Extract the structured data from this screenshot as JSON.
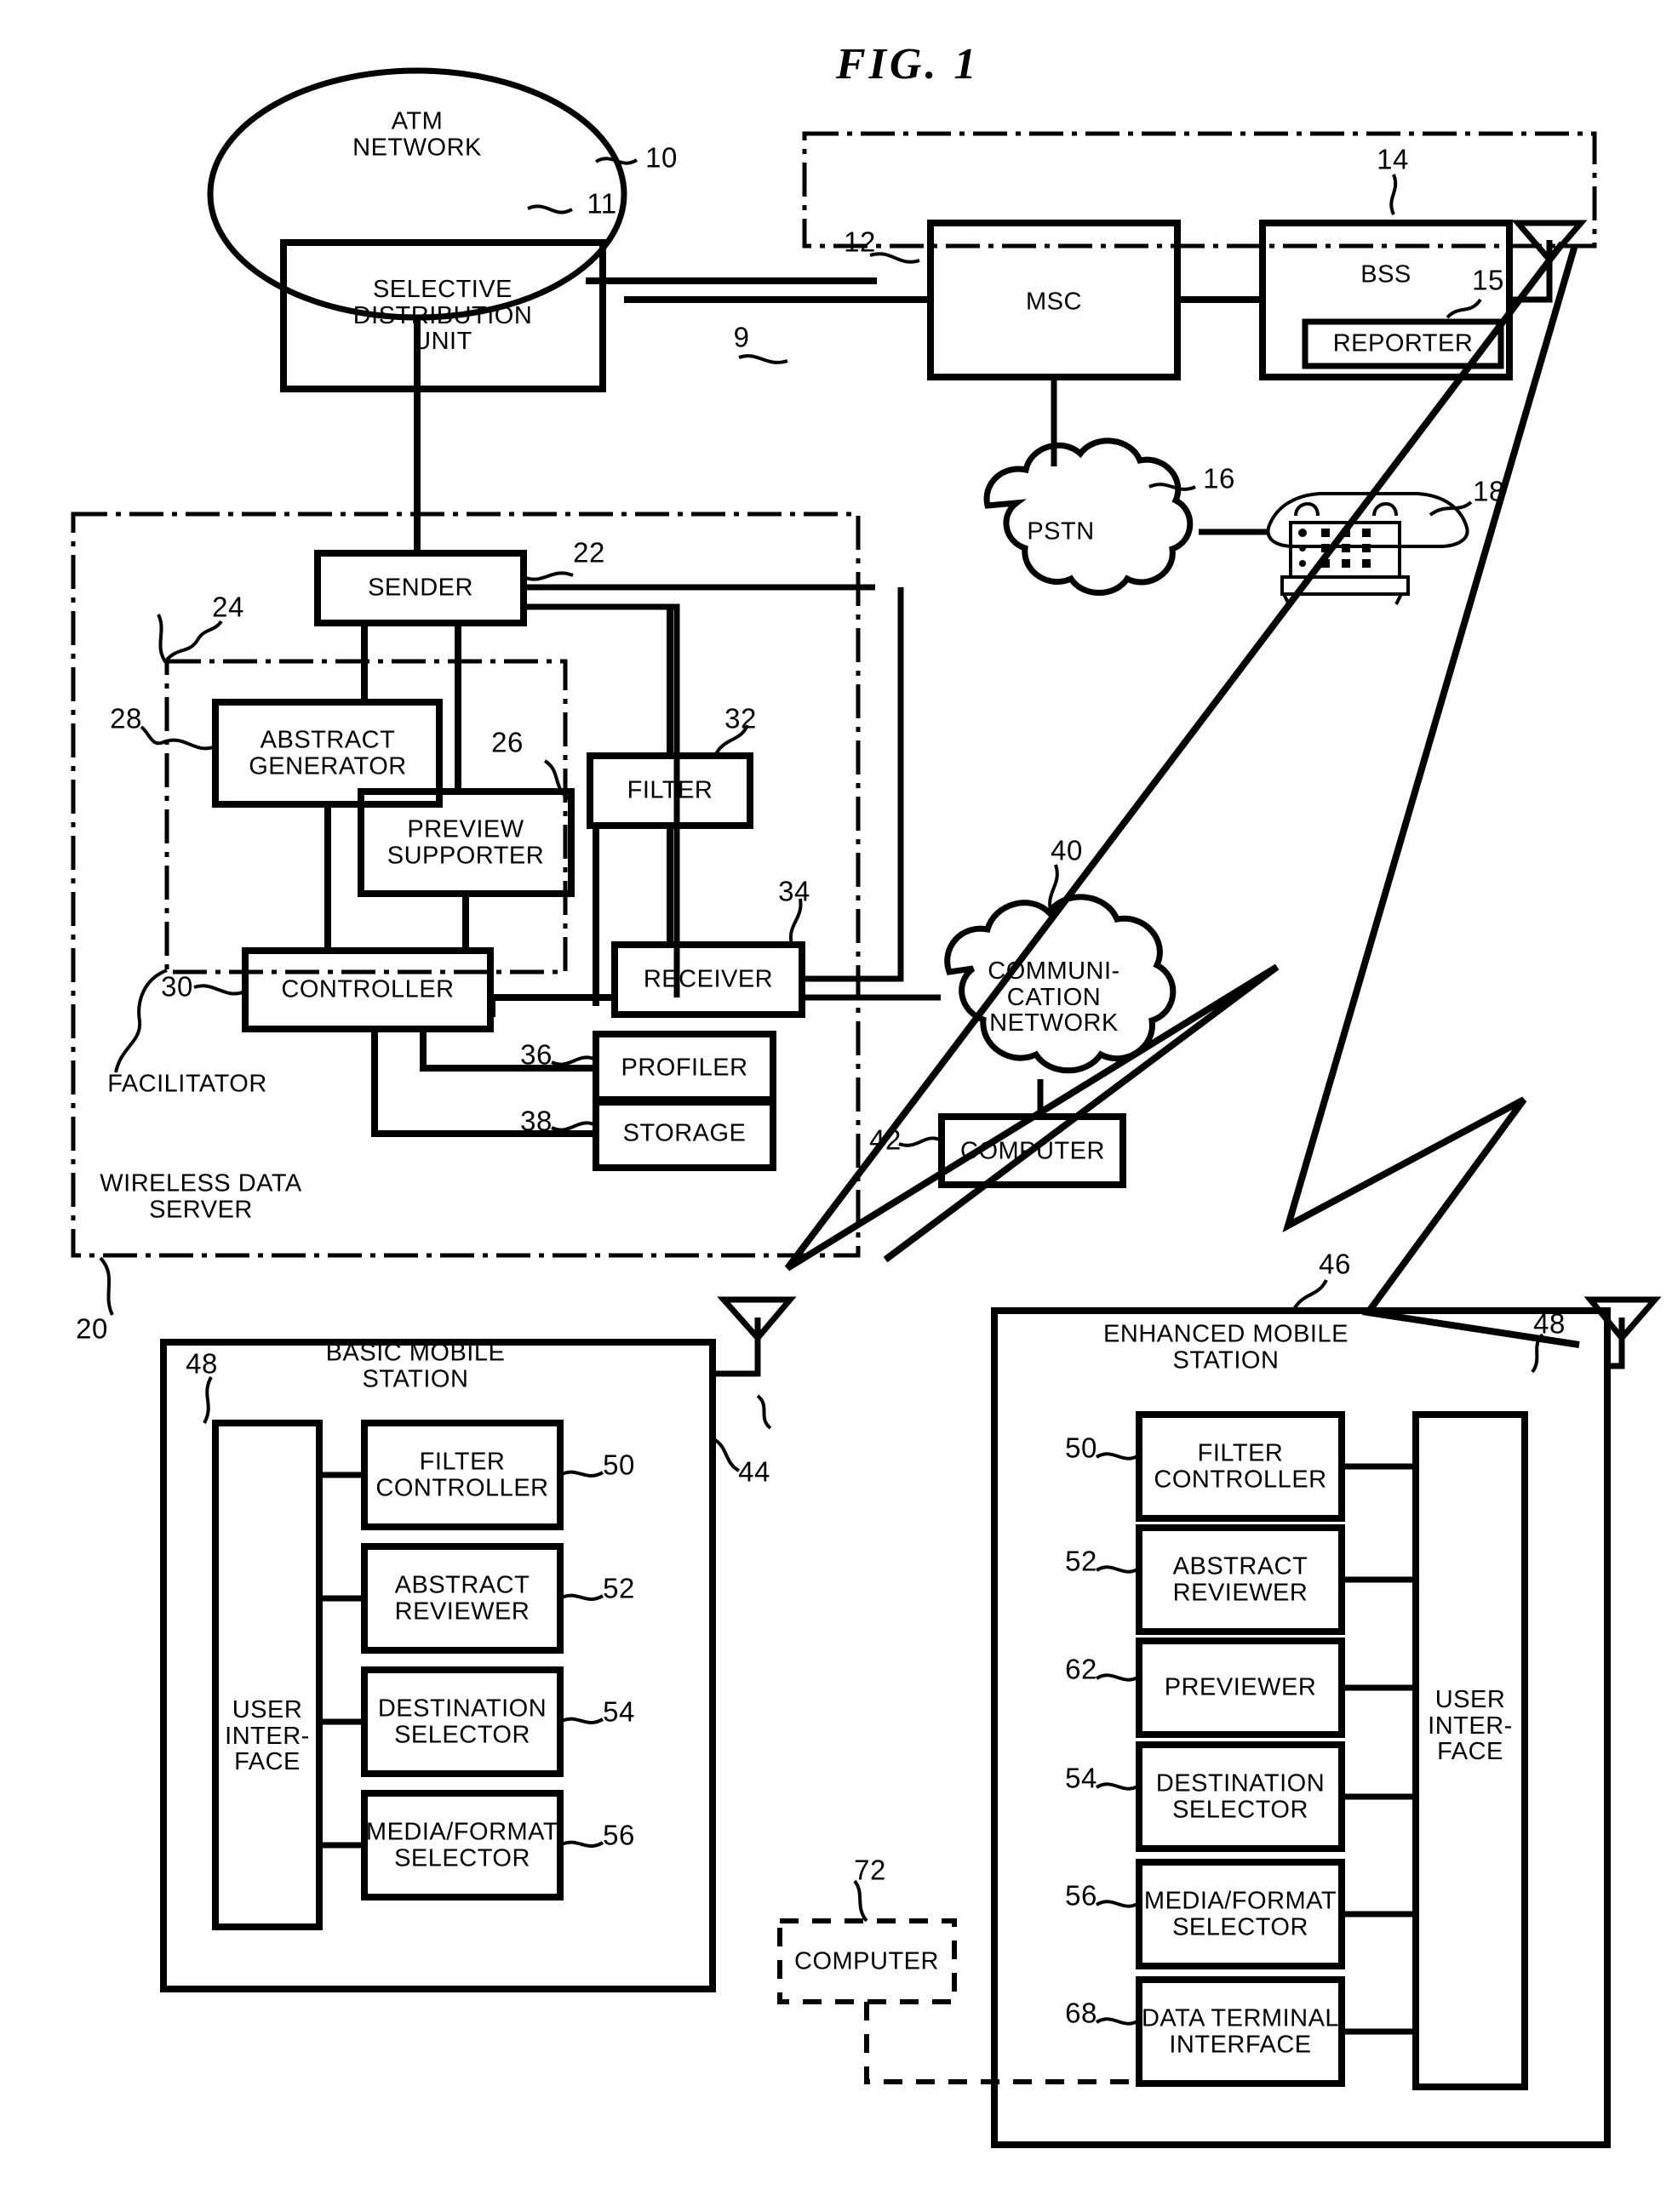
{
  "figure": {
    "title": "FIG. 1"
  },
  "blocks": {
    "atm_network": "ATM\nNETWORK",
    "selective_distribution_unit": "SELECTIVE\nDISTRIBUTION\nUNIT",
    "msc": "MSC",
    "bss": "BSS",
    "reporter": "REPORTER",
    "pstn": "PSTN",
    "sender": "SENDER",
    "abstract_generator": "ABSTRACT\nGENERATOR",
    "preview_supporter": "PREVIEW\nSUPPORTER",
    "filter": "FILTER",
    "receiver": "RECEIVER",
    "controller": "CONTROLLER",
    "profiler": "PROFILER",
    "storage": "STORAGE",
    "facilitator": "FACILITATOR",
    "wireless_data_server": "WIRELESS DATA\nSERVER",
    "communication_network": "COMMUNI-\nCATION\nNETWORK",
    "computer_network": "COMPUTER",
    "basic_mobile_station": "BASIC MOBILE\nSTATION",
    "enhanced_mobile_station": "ENHANCED MOBILE\nSTATION",
    "user_interface_basic": "USER\nINTER-\nFACE",
    "user_interface_enhanced": "USER\nINTER-\nFACE",
    "filter_controller_basic": "FILTER\nCONTROLLER",
    "abstract_reviewer_basic": "ABSTRACT\nREVIEWER",
    "destination_selector_basic": "DESTINATION\nSELECTOR",
    "media_format_selector_basic": "MEDIA/FORMAT\nSELECTOR",
    "filter_controller_enh": "FILTER\nCONTROLLER",
    "abstract_reviewer_enh": "ABSTRACT\nREVIEWER",
    "previewer_enh": "PREVIEWER",
    "destination_selector_enh": "DESTINATION\nSELECTOR",
    "media_format_selector_enh": "MEDIA/FORMAT\nSELECTOR",
    "data_terminal_interface": "DATA TERMINAL\nINTERFACE",
    "computer_terminal": "COMPUTER"
  },
  "refs": {
    "r9": "9",
    "r10": "10",
    "r11": "11",
    "r12": "12",
    "r14": "14",
    "r15": "15",
    "r16": "16",
    "r18": "18",
    "r20": "20",
    "r22": "22",
    "r24": "24",
    "r26": "26",
    "r28": "28",
    "r30": "30",
    "r32": "32",
    "r34": "34",
    "r36": "36",
    "r38": "38",
    "r40": "40",
    "r42": "42",
    "r44": "44",
    "r46": "46",
    "r48_basic": "48",
    "r48_enh": "48",
    "r50_basic": "50",
    "r50_enh": "50",
    "r52_basic": "52",
    "r52_enh": "52",
    "r54_basic": "54",
    "r54_enh": "54",
    "r56_basic": "56",
    "r56_enh": "56",
    "r62": "62",
    "r68": "68",
    "r72": "72"
  },
  "colors": {
    "ink": "#000000",
    "paper": "#ffffff"
  }
}
